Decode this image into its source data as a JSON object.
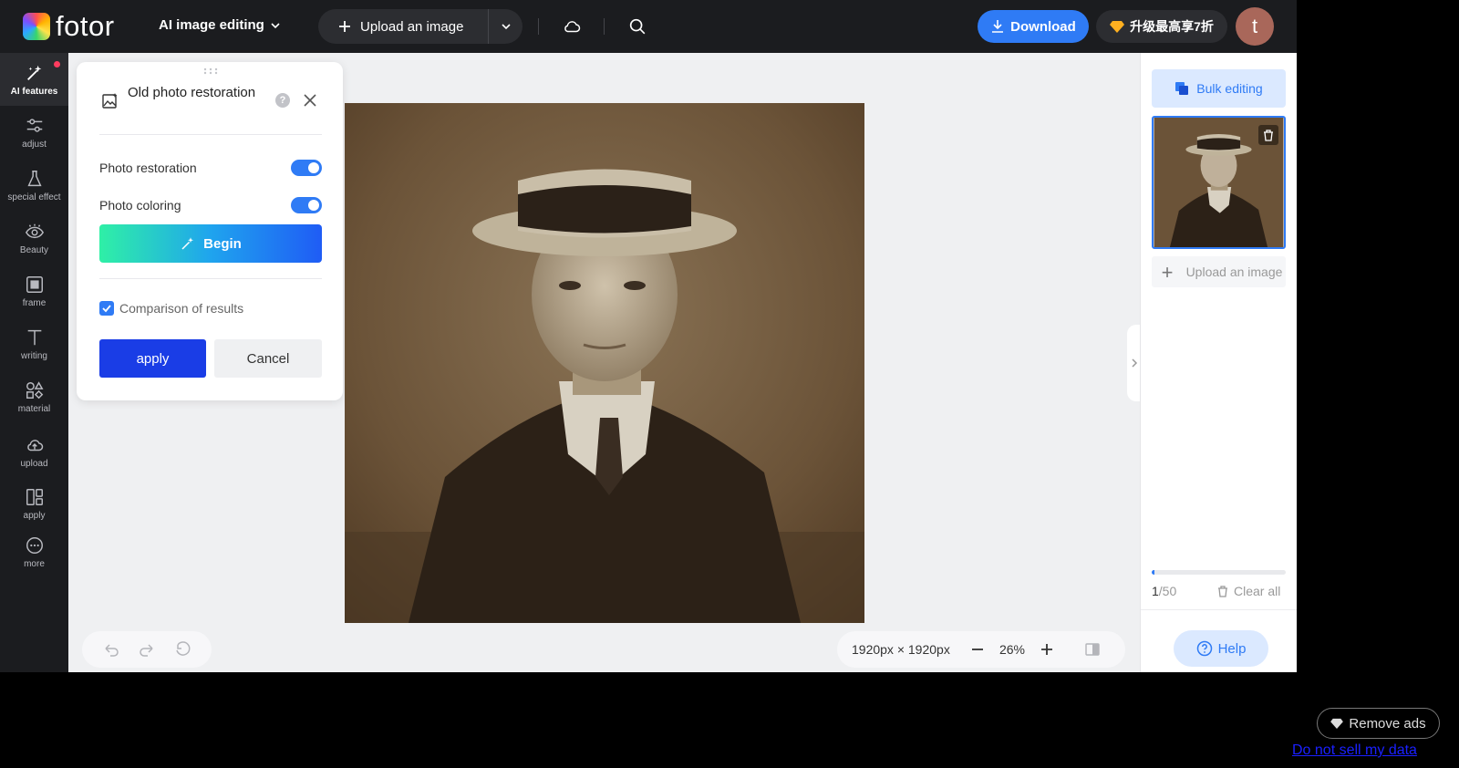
{
  "header": {
    "logo_text": "fotor",
    "mode_menu": "AI image editing",
    "upload_label": "Upload an image",
    "download_label": "Download",
    "upgrade_label": "升级最高享7折",
    "avatar_letter": "t"
  },
  "sidebar": {
    "items": [
      {
        "label": "AI features",
        "icon": "magic-wand-icon"
      },
      {
        "label": "adjust",
        "icon": "sliders-icon"
      },
      {
        "label": "special effect",
        "icon": "flask-icon"
      },
      {
        "label": "Beauty",
        "icon": "eye-icon"
      },
      {
        "label": "frame",
        "icon": "frame-icon"
      },
      {
        "label": "writing",
        "icon": "text-icon"
      },
      {
        "label": "material",
        "icon": "shapes-icon"
      },
      {
        "label": "upload",
        "icon": "cloud-upload-icon"
      },
      {
        "label": "apply",
        "icon": "templates-icon"
      },
      {
        "label": "more",
        "icon": "more-dots-icon"
      }
    ]
  },
  "panel": {
    "title": "Old photo restoration",
    "help_glyph": "?",
    "option1": "Photo restoration",
    "option2": "Photo coloring",
    "begin_label": "Begin",
    "compare_label": "Comparison of results",
    "apply_label": "apply",
    "cancel_label": "Cancel"
  },
  "canvas": {
    "dimensions": "1920px × 1920px",
    "zoom": "26%"
  },
  "right": {
    "bulk_label": "Bulk editing",
    "upload_label": "Upload an image",
    "count_current": "1",
    "count_total": "/50",
    "progress_fraction": 0.02,
    "clear_label": "Clear all",
    "help_label": "Help"
  },
  "footer": {
    "remove_ads": "Remove ads",
    "do_not_sell": "Do not sell my data"
  },
  "colors": {
    "accent": "#2f7bf5",
    "apply_button": "#1a3de6",
    "topbar": "#1b1c1f"
  }
}
